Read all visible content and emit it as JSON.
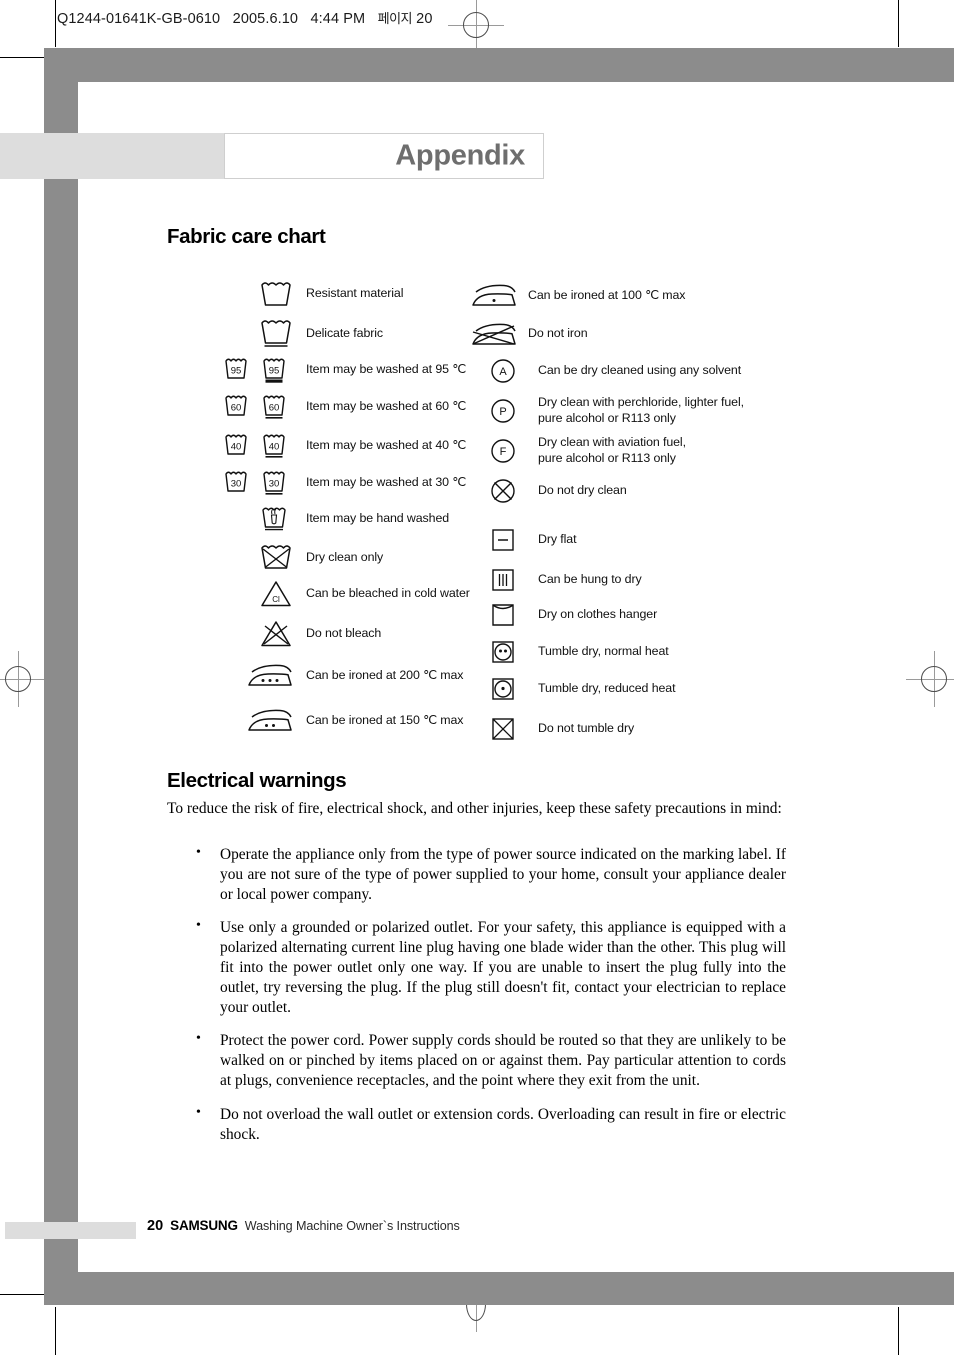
{
  "print_slug": {
    "code": "Q1244-01641K-GB-0610",
    "date": "2005.6.10",
    "time": "4:44 PM",
    "korean": "페이지",
    "page": "20"
  },
  "header": {
    "title": "Appendix"
  },
  "sections": {
    "fabric_care_heading": "Fabric care chart",
    "electrical_heading": "Electrical warnings"
  },
  "care_chart": {
    "left_column": [
      {
        "icon": "wash-tub-icon",
        "label": "Resistant material"
      },
      {
        "icon": "wash-tub-delicate-icon",
        "label": "Delicate fabric"
      },
      {
        "icon": "wash-tub-95-pair-icon",
        "label": "Item may be washed at 95 ℃"
      },
      {
        "icon": "wash-tub-60-pair-icon",
        "label": "Item may be washed at 60 ℃"
      },
      {
        "icon": "wash-tub-40-pair-icon",
        "label": "Item may be washed at 40 ℃"
      },
      {
        "icon": "wash-tub-30-pair-icon",
        "label": "Item may be washed at 30 ℃"
      },
      {
        "icon": "hand-wash-icon",
        "label": "Item may be hand washed"
      },
      {
        "icon": "dry-clean-only-icon",
        "label": "Dry clean only"
      },
      {
        "icon": "bleach-cold-water-icon",
        "label": "Can be bleached in cold water"
      },
      {
        "icon": "do-not-bleach-icon",
        "label": "Do not bleach"
      },
      {
        "icon": "iron-three-dots-icon",
        "label": "Can be ironed at 200 ℃ max"
      },
      {
        "icon": "iron-two-dots-icon",
        "label": "Can be ironed at 150 ℃ max"
      }
    ],
    "right_column": [
      {
        "icon": "iron-one-dot-icon",
        "label": "Can be ironed at 100 ℃  max"
      },
      {
        "icon": "do-not-iron-icon",
        "label": "Do not iron"
      },
      {
        "icon": "dry-clean-a-icon",
        "label": "Can be dry cleaned using any solvent"
      },
      {
        "icon": "dry-clean-p-icon",
        "label": "Dry clean with perchloride, lighter fuel,\npure alcohol or R113 only"
      },
      {
        "icon": "dry-clean-f-icon",
        "label": "Dry clean with aviation fuel,\npure alcohol or R113 only"
      },
      {
        "icon": "do-not-dry-clean-icon",
        "label": "Do not dry clean"
      },
      {
        "icon": "dry-flat-icon",
        "label": "Dry flat"
      },
      {
        "icon": "hang-to-dry-icon",
        "label": "Can be hung to dry"
      },
      {
        "icon": "drip-dry-hanger-icon",
        "label": "Dry on clothes hanger"
      },
      {
        "icon": "tumble-dry-normal-icon",
        "label": " Tumble dry, normal heat"
      },
      {
        "icon": "tumble-dry-reduced-icon",
        "label": "Tumble dry, reduced heat"
      },
      {
        "icon": "do-not-tumble-dry-icon",
        "label": "Do not tumble dry"
      }
    ],
    "tub_numbers": {
      "t95": "95",
      "t60": "60",
      "t40": "40",
      "t30": "30"
    },
    "bleach_letter": "Cl",
    "dry_clean_letters": {
      "a": "A",
      "p": "P",
      "f": "F"
    }
  },
  "electrical": {
    "intro": "To reduce the risk of fire, electrical shock, and other injuries, keep these safety precautions in mind:",
    "bullets": [
      "Operate the appliance only from the type of power source indicated on the marking label.  If you are not sure of the type of power supplied to your home, consult your appliance dealer or local power company.",
      "Use only a grounded or polarized outlet.  For your safety, this appliance is equipped with a polarized alternating current line plug having one blade wider than the other. This plug will fit into the power outlet only one way.  If you are unable to insert the plug fully into the outlet, try reversing the plug.  If the plug still doesn't fit, contact your electrician to replace your outlet.",
      "Protect the power cord. Power supply cords should be routed so that they are unlikely to be walked on or pinched by items placed on or against them.  Pay particular attention to cords at plugs, convenience receptacles, and the point where they exit from the unit.",
      "Do not overload the wall outlet or extension cords.  Overloading can result in fire or electric shock."
    ]
  },
  "footer": {
    "page_number": "20",
    "brand": "SAMSUNG",
    "subtitle": "Washing Machine Owner`s Instructions"
  },
  "colors": {
    "frame_gray": "#8c8c8c",
    "band_gray": "#dddddd",
    "title_gray": "#6e6e6e"
  }
}
